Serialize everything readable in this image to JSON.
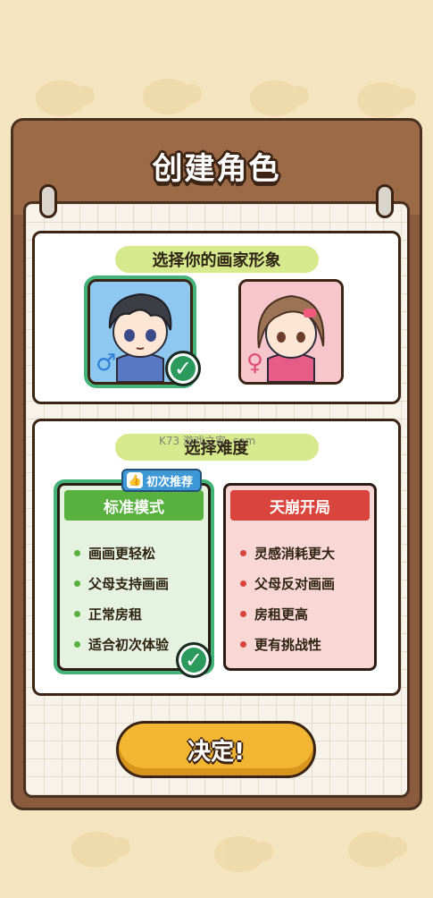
{
  "title": "创建角色",
  "section_avatar": {
    "label": "选择你的画家形象"
  },
  "avatars": [
    {
      "gender_symbol": "♂",
      "selected": true
    },
    {
      "gender_symbol": "♀",
      "selected": false
    }
  ],
  "section_mode": {
    "label": "选择难度"
  },
  "badge": {
    "label": "初次推荐",
    "icon": "thumbs-up-icon"
  },
  "modes": {
    "standard": {
      "title": "标准模式",
      "features": [
        "画画更轻松",
        "父母支持画画",
        "正常房租",
        "适合初次体验"
      ],
      "selected": true
    },
    "hard": {
      "title": "天崩开局",
      "features": [
        "灵感消耗更大",
        "父母反对画画",
        "房租更高",
        "更有挑战性"
      ],
      "selected": false
    }
  },
  "confirm_button": {
    "label": "决定!"
  },
  "watermark": "K73 游戏之家 .com",
  "colors": {
    "standard": "#58b13f",
    "hard": "#d9453c",
    "confirm": "#f2b632",
    "selected_ring": "#43b37a"
  }
}
